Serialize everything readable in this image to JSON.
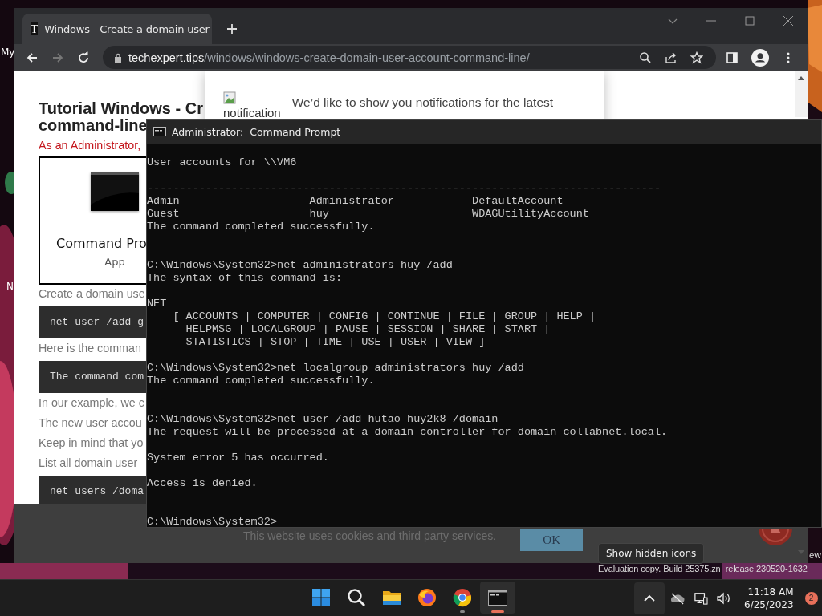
{
  "desktop": {
    "icon_labels": [
      "My",
      "N"
    ],
    "edition_tail": "ew",
    "build_info": "Evaluation copy. Build 25375.zn_release.230520-1632"
  },
  "browser": {
    "tabs": [
      {
        "favicon": "T",
        "title": "Windows - Create a domain user",
        "selected": true
      }
    ],
    "url": {
      "host": "techexpert.tips",
      "path": "/windows/windows-create-domain-user-account-command-line/"
    },
    "page": {
      "heading": [
        "Tutorial Windows - Cr",
        "command-line"
      ],
      "intro": "As an Administrator,",
      "figure": {
        "title": "Command Pro",
        "subtitle": "App"
      },
      "content": [
        {
          "kind": "text",
          "text": "Create a domain use"
        },
        {
          "kind": "code",
          "text": "net user /add g"
        },
        {
          "kind": "text",
          "text": "Here is the comman"
        },
        {
          "kind": "code",
          "text": "The command com"
        },
        {
          "kind": "text",
          "text": "In our example, we c"
        },
        {
          "kind": "text",
          "text": "The new user accou"
        },
        {
          "kind": "text",
          "text": "Keep in mind that yo"
        },
        {
          "kind": "text",
          "text": "List all domain user"
        },
        {
          "kind": "code",
          "text": "net users /doma"
        }
      ],
      "notification": {
        "image_alt": "notification",
        "text": "We’d like to show you notifications for the latest"
      },
      "cookie_bar": {
        "text": "This website uses cookies and third party services.",
        "button": "OK"
      }
    }
  },
  "console": {
    "title": "Administrator:  Command Prompt",
    "output": "User accounts for \\\\VM6\n\n-------------------------------------------------------------------------------\nAdmin                    Administrator            DefaultAccount\nGuest                    huy                      WDAGUtilityAccount\nThe command completed successfully.\n\n\nC:\\Windows\\System32>net administrators huy /add\nThe syntax of this command is:\n\nNET\n    [ ACCOUNTS | COMPUTER | CONFIG | CONTINUE | FILE | GROUP | HELP |\n      HELPMSG | LOCALGROUP | PAUSE | SESSION | SHARE | START |\n      STATISTICS | STOP | TIME | USE | USER | VIEW ]\n\nC:\\Windows\\System32>net localgroup administrators huy /add\nThe command completed successfully.\n\n\nC:\\Windows\\System32>net user /add hutao huy2k8 /domain\nThe request will be processed at a domain controller for domain collabnet.local.\n\nSystem error 5 has occurred.\n\nAccess is denied.\n\n\nC:\\Windows\\System32>"
  },
  "tooltip": "Show hidden icons",
  "taskbar": {
    "apps": [
      {
        "kind": "start",
        "running": false,
        "selected": false
      },
      {
        "kind": "search",
        "running": false,
        "selected": false
      },
      {
        "kind": "files",
        "running": false,
        "selected": false
      },
      {
        "kind": "firefox",
        "running": false,
        "selected": false
      },
      {
        "kind": "chrome",
        "running": true,
        "selected": false
      },
      {
        "kind": "terminal",
        "running": true,
        "selected": true
      }
    ],
    "time": "11:18 AM",
    "date": "6/25/2023",
    "notifications": "2"
  }
}
